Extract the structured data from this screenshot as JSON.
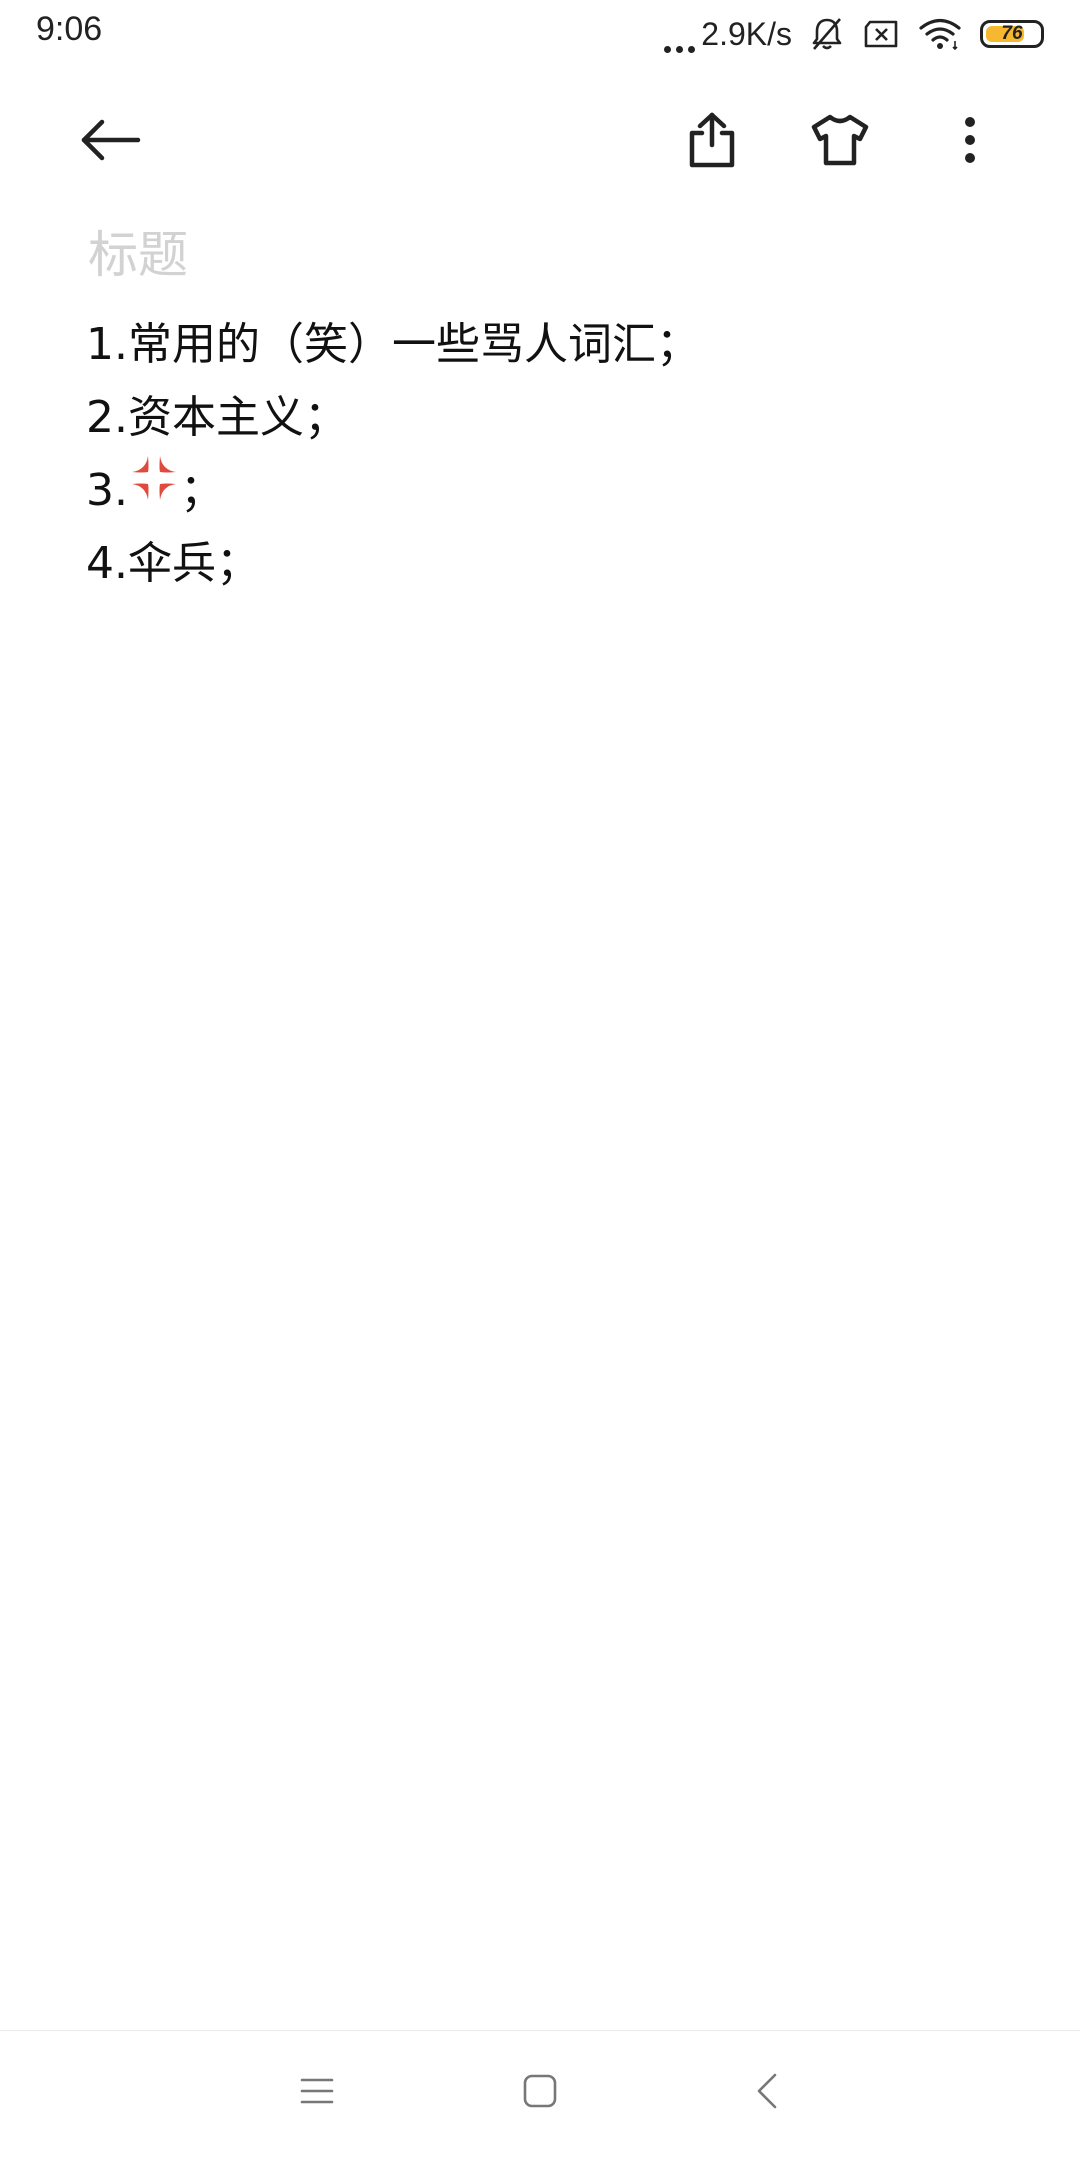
{
  "status_bar": {
    "time": "9:06",
    "network_speed": "2.9K/s",
    "battery_level": "76",
    "battery_fraction": 0.76,
    "icons": [
      "more-dots-icon",
      "bell-muted-icon",
      "sim-x-icon",
      "wifi-icon",
      "battery-icon"
    ]
  },
  "toolbar": {
    "icons": [
      "back-arrow-icon",
      "share-icon",
      "tshirt-theme-icon",
      "more-vert-icon"
    ]
  },
  "note": {
    "title_placeholder": "标题",
    "lines": [
      {
        "number": "1.",
        "text": "常用的（笑）一些骂人词汇；"
      },
      {
        "number": "2.",
        "text": "资本主义；"
      },
      {
        "number": "3.",
        "text": "；",
        "emoji": "anger-symbol-icon"
      },
      {
        "number": "4.",
        "text": "伞兵；"
      }
    ]
  },
  "nav_bar": {
    "icons": [
      "menu-icon",
      "home-square-icon",
      "back-chevron-icon"
    ]
  },
  "colors": {
    "accent_battery": "#f5b82e",
    "title_placeholder": "#d2d2d2",
    "text": "#111111",
    "emoji_red": "#e04a3c"
  }
}
